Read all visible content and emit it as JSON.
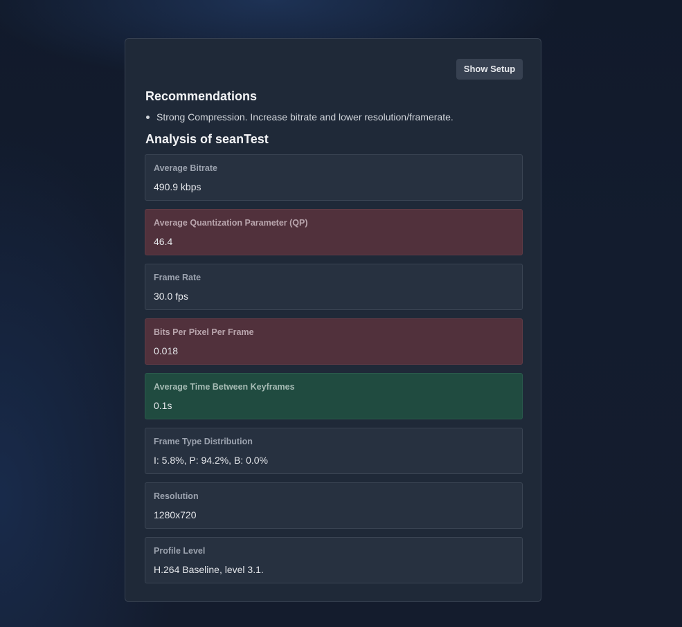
{
  "toolbar": {
    "show_setup_label": "Show Setup"
  },
  "recommendations": {
    "title": "Recommendations",
    "items": [
      "Strong Compression. Increase bitrate and lower resolution/framerate."
    ]
  },
  "analysis": {
    "title": "Analysis of seanTest",
    "metrics": [
      {
        "label": "Average Bitrate",
        "value": "490.9 kbps",
        "status": "neutral"
      },
      {
        "label": "Average Quantization Parameter (QP)",
        "value": "46.4",
        "status": "bad"
      },
      {
        "label": "Frame Rate",
        "value": "30.0 fps",
        "status": "neutral"
      },
      {
        "label": "Bits Per Pixel Per Frame",
        "value": "0.018",
        "status": "bad"
      },
      {
        "label": "Average Time Between Keyframes",
        "value": "0.1s",
        "status": "good"
      },
      {
        "label": "Frame Type Distribution",
        "value": "I: 5.8%, P: 94.2%, B: 0.0%",
        "status": "neutral"
      },
      {
        "label": "Resolution",
        "value": "1280x720",
        "status": "neutral"
      },
      {
        "label": "Profile Level",
        "value": "H.264 Baseline, level 3.1.",
        "status": "neutral"
      }
    ]
  },
  "colors": {
    "neutral": "#273140",
    "bad": "#51313c",
    "good": "#204b40"
  }
}
